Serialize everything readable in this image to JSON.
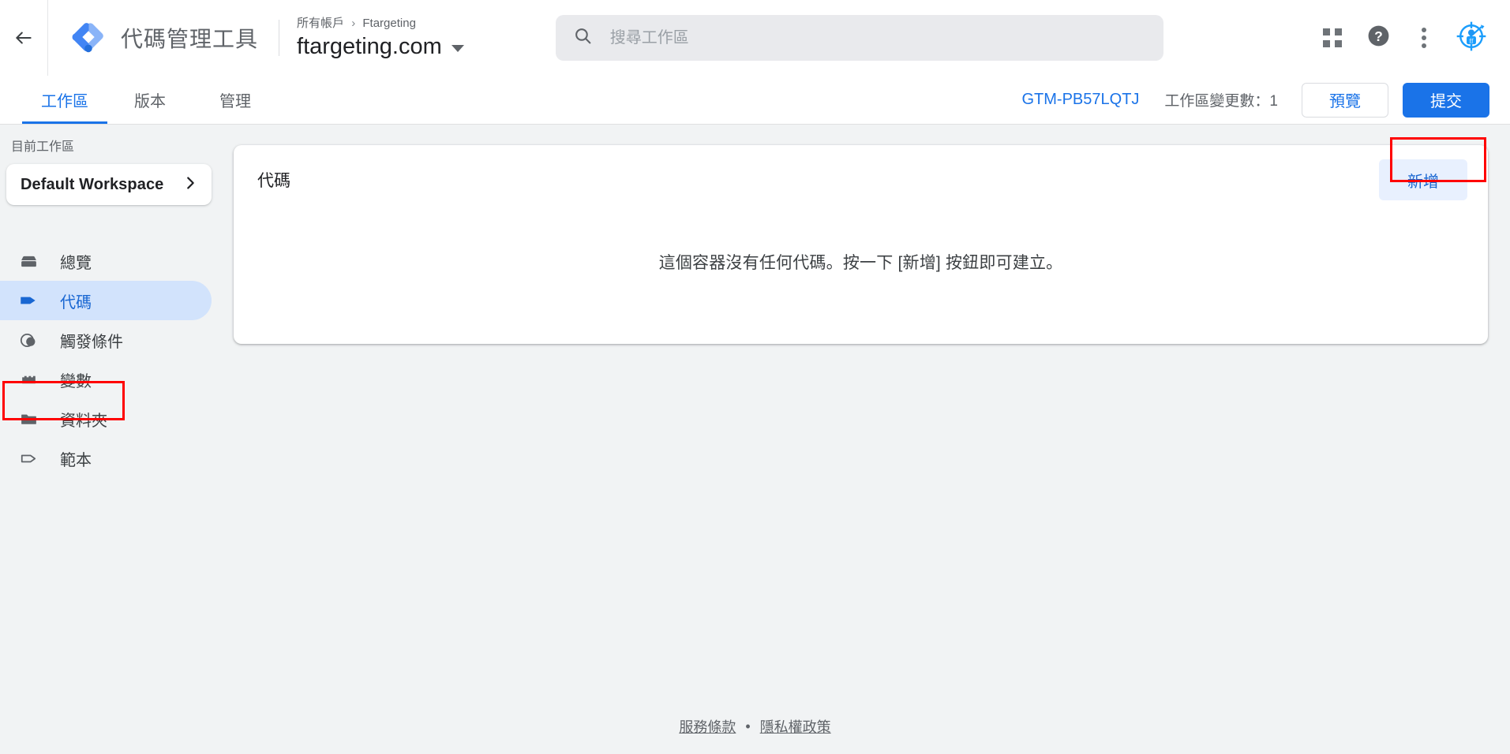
{
  "header": {
    "back_icon": "arrow-left-icon",
    "logo_icon": "google-tag-manager-logo",
    "product_title": "代碼管理工具",
    "breadcrumb_account": "所有帳戶",
    "breadcrumb_separator": "›",
    "breadcrumb_current": "Ftargeting",
    "container_name": "ftargeting.com",
    "container_dropdown_icon": "caret-down-icon",
    "search": {
      "icon": "search-icon",
      "placeholder": "搜尋工作區",
      "value": ""
    },
    "apps_icon": "apps-grid-icon",
    "help_icon": "help-circle-icon",
    "more_icon": "more-vert-icon",
    "avatar_icon": "target-account-icon"
  },
  "tabbar": {
    "tabs": [
      {
        "label": "工作區",
        "active": true
      },
      {
        "label": "版本",
        "active": false
      },
      {
        "label": "管理",
        "active": false
      }
    ],
    "container_id": "GTM-PB57LQTJ",
    "changes_label": "工作區變更數：1",
    "preview_label": "預覽",
    "submit_label": "提交"
  },
  "sidebar": {
    "current_workspace_label": "目前工作區",
    "workspace_name": "Default Workspace",
    "workspace_chevron_icon": "chevron-right-icon",
    "items": [
      {
        "label": "總覽",
        "icon": "overview-box-icon",
        "active": false
      },
      {
        "label": "代碼",
        "icon": "tag-icon",
        "active": true
      },
      {
        "label": "觸發條件",
        "icon": "trigger-circles-icon",
        "active": false
      },
      {
        "label": "變數",
        "icon": "variable-block-icon",
        "active": false
      },
      {
        "label": "資料夾",
        "icon": "folder-icon",
        "active": false
      },
      {
        "label": "範本",
        "icon": "template-tag-icon",
        "active": false
      }
    ]
  },
  "main": {
    "card_title": "代碼",
    "add_button_label": "新增",
    "empty_message": "這個容器沒有任何代碼。按一下 [新增] 按鈕即可建立。"
  },
  "footer": {
    "terms_label": "服務條款",
    "separator": "•",
    "privacy_label": "隱私權政策"
  },
  "annotations": {
    "accent_color": "#ff0000",
    "highlighted": [
      "sidebar-item-tags",
      "add-tag-button"
    ]
  }
}
